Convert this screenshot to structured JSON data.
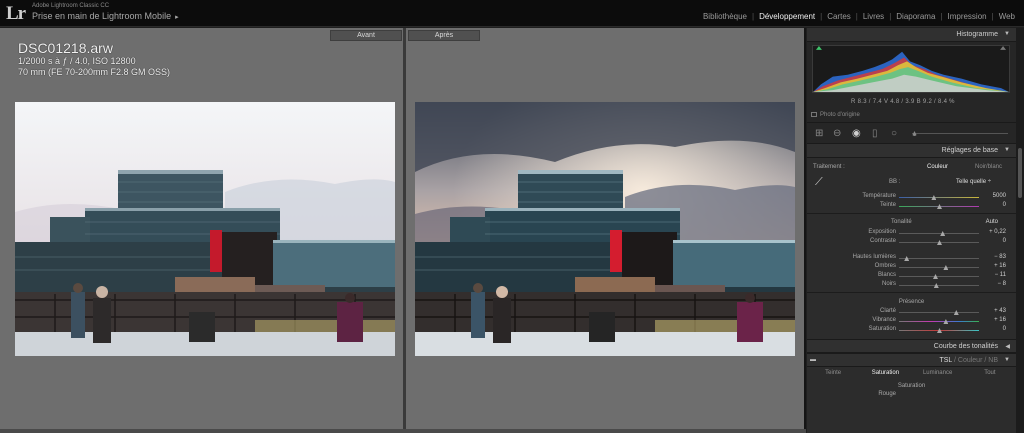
{
  "app": {
    "logo": "Lr",
    "name": "Adobe Lightroom Classic CC",
    "catalog": "Prise en main de Lightroom Mobile",
    "catalog_arrow": "▸"
  },
  "modules": [
    "Bibliothèque",
    "Développement",
    "Cartes",
    "Livres",
    "Diaporama",
    "Impression",
    "Web"
  ],
  "active_module": "Développement",
  "canvas": {
    "before_label": "Avant",
    "after_label": "Après",
    "file_name": "DSC01218.arw",
    "exposure_line": "1/2000 s à ƒ / 4.0, ISO 12800",
    "lens_line": "70 mm (FE 70-200mm F2.8 GM OSS)"
  },
  "panel": {
    "histogram": {
      "title": "Histogramme",
      "readout": "R  8.3 /  7.4   V  4.8 /  3.9   B  9.2 /  8.4  %",
      "original_photo": "Photo d'origine"
    },
    "basic": {
      "title": "Réglages de base",
      "treatment_label": "Traitement :",
      "treatment_color": "Couleur",
      "treatment_bw": "Noir/blanc",
      "wb_label": "BB :",
      "wb_value": "Telle quelle ÷",
      "temperature": {
        "label": "Température",
        "value": "5000",
        "pos": 0.43
      },
      "tint": {
        "label": "Teinte",
        "value": "0",
        "pos": 0.5
      },
      "tone_label": "Tonalité",
      "auto_label": "Auto",
      "exposure": {
        "label": "Exposition",
        "value": "+ 0,22",
        "pos": 0.54
      },
      "contrast": {
        "label": "Contraste",
        "value": "0",
        "pos": 0.5
      },
      "highlights": {
        "label": "Hautes lumières",
        "value": "− 83",
        "pos": 0.09
      },
      "shadows": {
        "label": "Ombres",
        "value": "+ 16",
        "pos": 0.58
      },
      "whites": {
        "label": "Blancs",
        "value": "− 11",
        "pos": 0.45
      },
      "blacks": {
        "label": "Noirs",
        "value": "− 8",
        "pos": 0.46
      },
      "presence_label": "Présence",
      "clarity": {
        "label": "Clarté",
        "value": "+ 43",
        "pos": 0.71
      },
      "vibrance": {
        "label": "Vibrance",
        "value": "+ 16",
        "pos": 0.58
      },
      "saturation": {
        "label": "Saturation",
        "value": "0",
        "pos": 0.5
      }
    },
    "tone_curve": {
      "title": "Courbe des tonalités"
    },
    "hsl": {
      "title_tsl": "TSL",
      "title_sep1": "/",
      "title_color": "Couleur",
      "title_sep2": "/",
      "title_nb": "NB",
      "tabs": [
        "Teinte",
        "Saturation",
        "Luminance",
        "Tout"
      ],
      "active_tab": "Saturation",
      "section": "Saturation",
      "first_row": "Rouge"
    }
  },
  "colors": {
    "canvas": "#6e6e6e",
    "panel": "#2c2c2c",
    "topbar": "#0c0c0c"
  }
}
